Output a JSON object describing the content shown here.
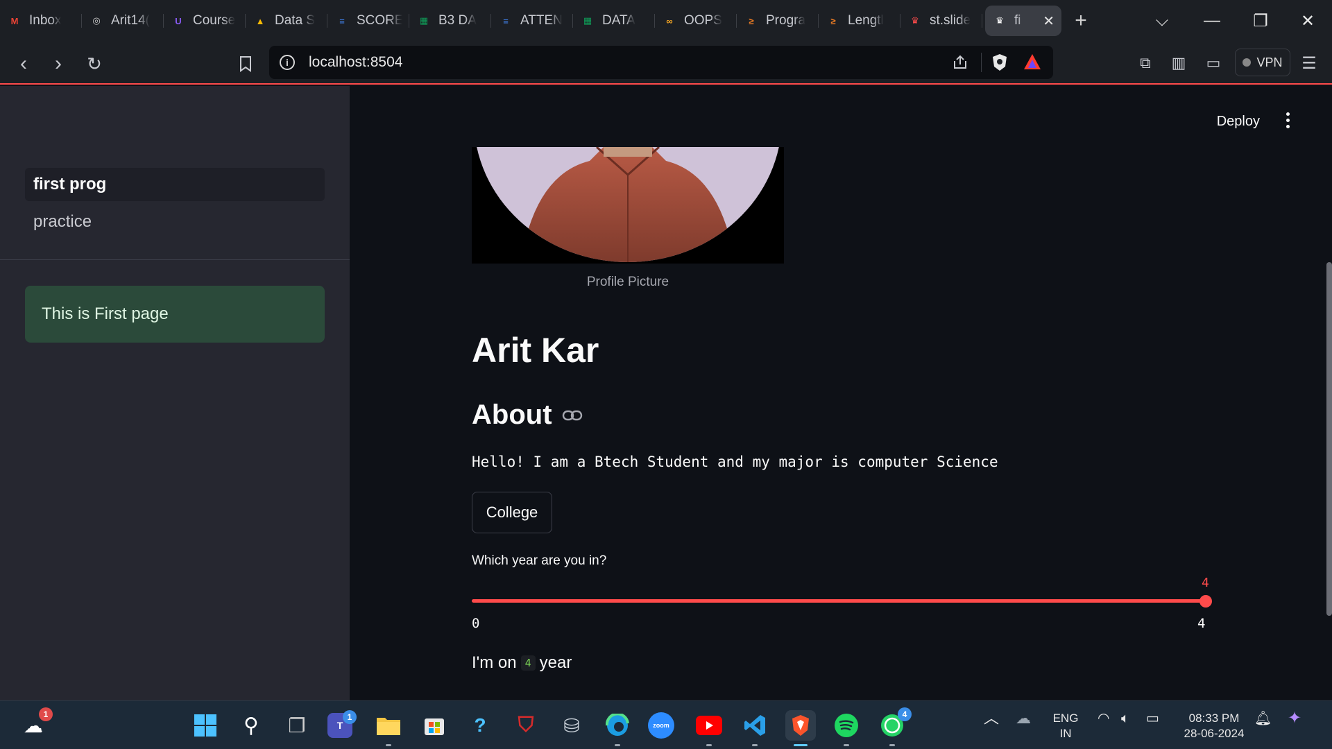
{
  "browser": {
    "tabs": [
      {
        "label": "Inbox",
        "icon": "gmail-icon",
        "color": "#ea4335",
        "glyph": "M"
      },
      {
        "label": "Arit14(",
        "icon": "github-icon",
        "color": "#d0d0d0",
        "glyph": "◎"
      },
      {
        "label": "Course",
        "icon": "course-icon",
        "color": "#8b5cf6",
        "glyph": "U"
      },
      {
        "label": "Data S",
        "icon": "google-drive-icon",
        "color": "#fbbc04",
        "glyph": "▲"
      },
      {
        "label": "SCORE",
        "icon": "google-docs-icon",
        "color": "#4285f4",
        "glyph": "≡"
      },
      {
        "label": "B3 DA",
        "icon": "google-sheets-icon",
        "color": "#0f9d58",
        "glyph": "▦"
      },
      {
        "label": "ATTEN",
        "icon": "google-docs-icon",
        "color": "#4285f4",
        "glyph": "≡"
      },
      {
        "label": "DATA",
        "icon": "google-sheets-icon",
        "color": "#0f9d58",
        "glyph": "▦"
      },
      {
        "label": "OOPS",
        "icon": "infinity-icon",
        "color": "#f5a623",
        "glyph": "∞"
      },
      {
        "label": "Progra",
        "icon": "stackoverflow-icon",
        "color": "#f48024",
        "glyph": "≥"
      },
      {
        "label": "Lengtl",
        "icon": "stackoverflow-icon",
        "color": "#f48024",
        "glyph": "≥"
      },
      {
        "label": "st.slide",
        "icon": "streamlit-icon",
        "color": "#ff4b4b",
        "glyph": "♛"
      },
      {
        "label": "fi",
        "icon": "streamlit-icon",
        "color": "#ffffff",
        "glyph": "♛",
        "active": true
      }
    ],
    "url": "localhost:8504",
    "vpn_label": "VPN"
  },
  "app": {
    "deploy_label": "Deploy",
    "sidebar": {
      "nav_items": [
        "first prog",
        "practice"
      ],
      "selected": 0,
      "alert_text": "This is First page"
    },
    "profile_caption": "Profile Picture",
    "title": "Arit Kar",
    "about_heading": "About",
    "about_text": "Hello! I am a Btech Student and my major is computer Science",
    "button_label": "College",
    "slider": {
      "label": "Which year are you in?",
      "min": 0,
      "max": 4,
      "value": 4,
      "min_label": "0",
      "max_label": "4",
      "value_label": "4"
    },
    "result": {
      "prefix": "I'm on",
      "value": "4",
      "suffix": "year"
    },
    "colors": {
      "primary": "#ff4b4b",
      "background": "#0e1117",
      "sidebar": "#262730",
      "success": "#2b4a3a"
    }
  },
  "taskbar": {
    "weather_badge": "1",
    "teams_badge": "1",
    "whatsapp_badge": "4",
    "language": "ENG",
    "region": "IN",
    "time": "08:33 PM",
    "date": "28-06-2024"
  }
}
